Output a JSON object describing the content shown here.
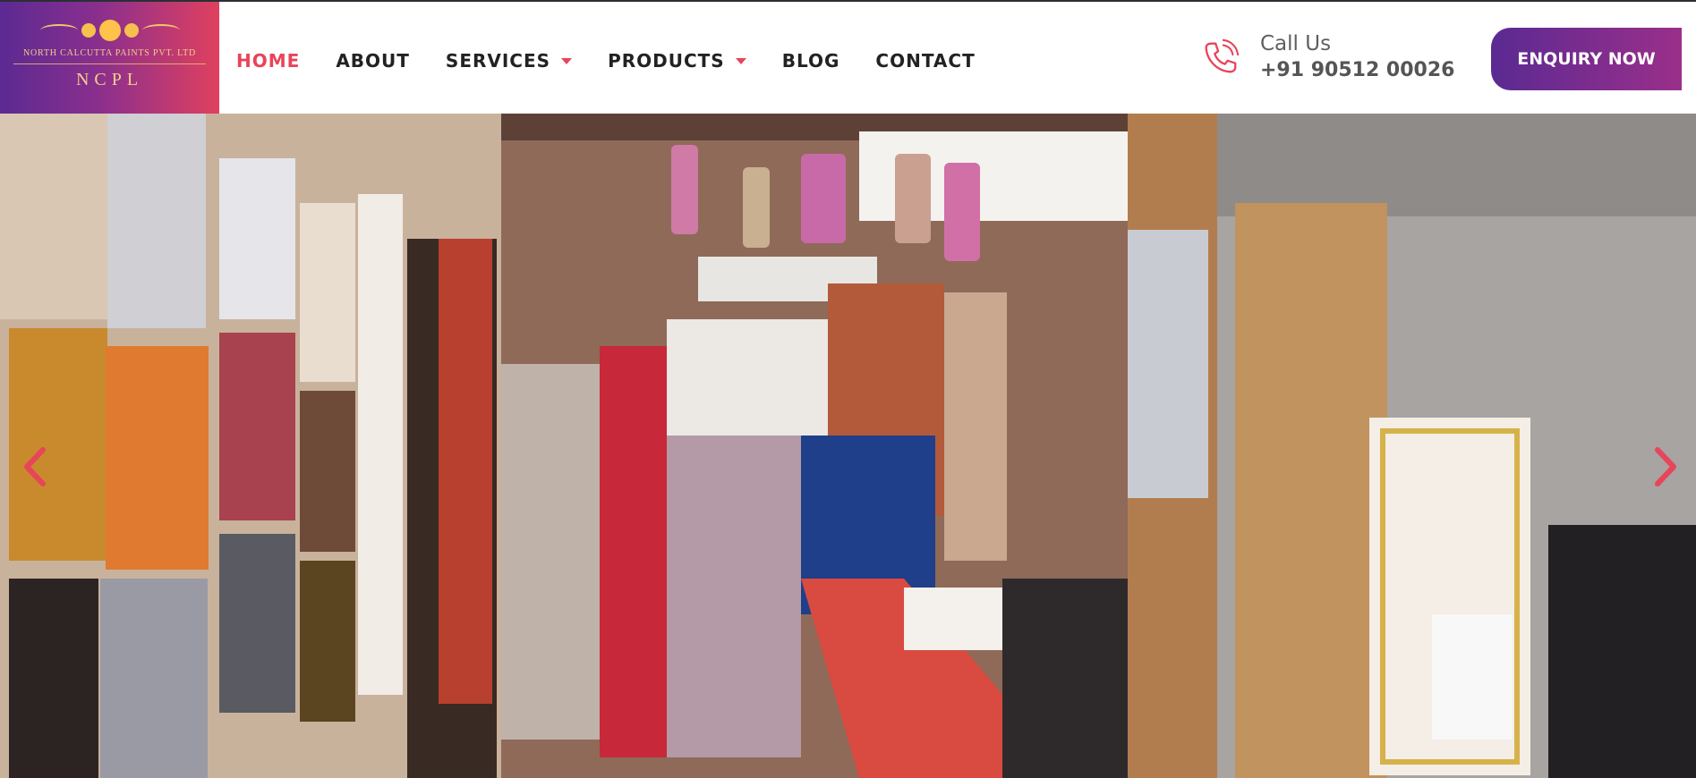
{
  "brand": {
    "company_name": "NORTH CALCUTTA PAINTS PVT. LTD",
    "abbreviation": "NCPL",
    "logo_gradient": [
      "#5b2a92",
      "#e0405f"
    ],
    "logo_gold": "#f0c66a"
  },
  "nav": {
    "items": [
      {
        "label": "HOME",
        "active": true,
        "has_dropdown": false
      },
      {
        "label": "ABOUT",
        "active": false,
        "has_dropdown": false
      },
      {
        "label": "SERVICES",
        "active": false,
        "has_dropdown": true
      },
      {
        "label": "PRODUCTS",
        "active": false,
        "has_dropdown": true
      },
      {
        "label": "BLOG",
        "active": false,
        "has_dropdown": false
      },
      {
        "label": "CONTACT",
        "active": false,
        "has_dropdown": false
      }
    ],
    "active_color": "#e8445a",
    "text_color": "#222222"
  },
  "contact": {
    "label": "Call Us",
    "phone": "+91 90512 00026",
    "icon": "phone-icon"
  },
  "cta": {
    "label": "ENQUIRY NOW",
    "gradient": [
      "#5a2a92",
      "#9b2f8a"
    ]
  },
  "hero": {
    "image": "paint-store-interior-photo",
    "prev_icon": "chevron-left-icon",
    "next_icon": "chevron-right-icon",
    "arrow_color": "#e8445a"
  }
}
